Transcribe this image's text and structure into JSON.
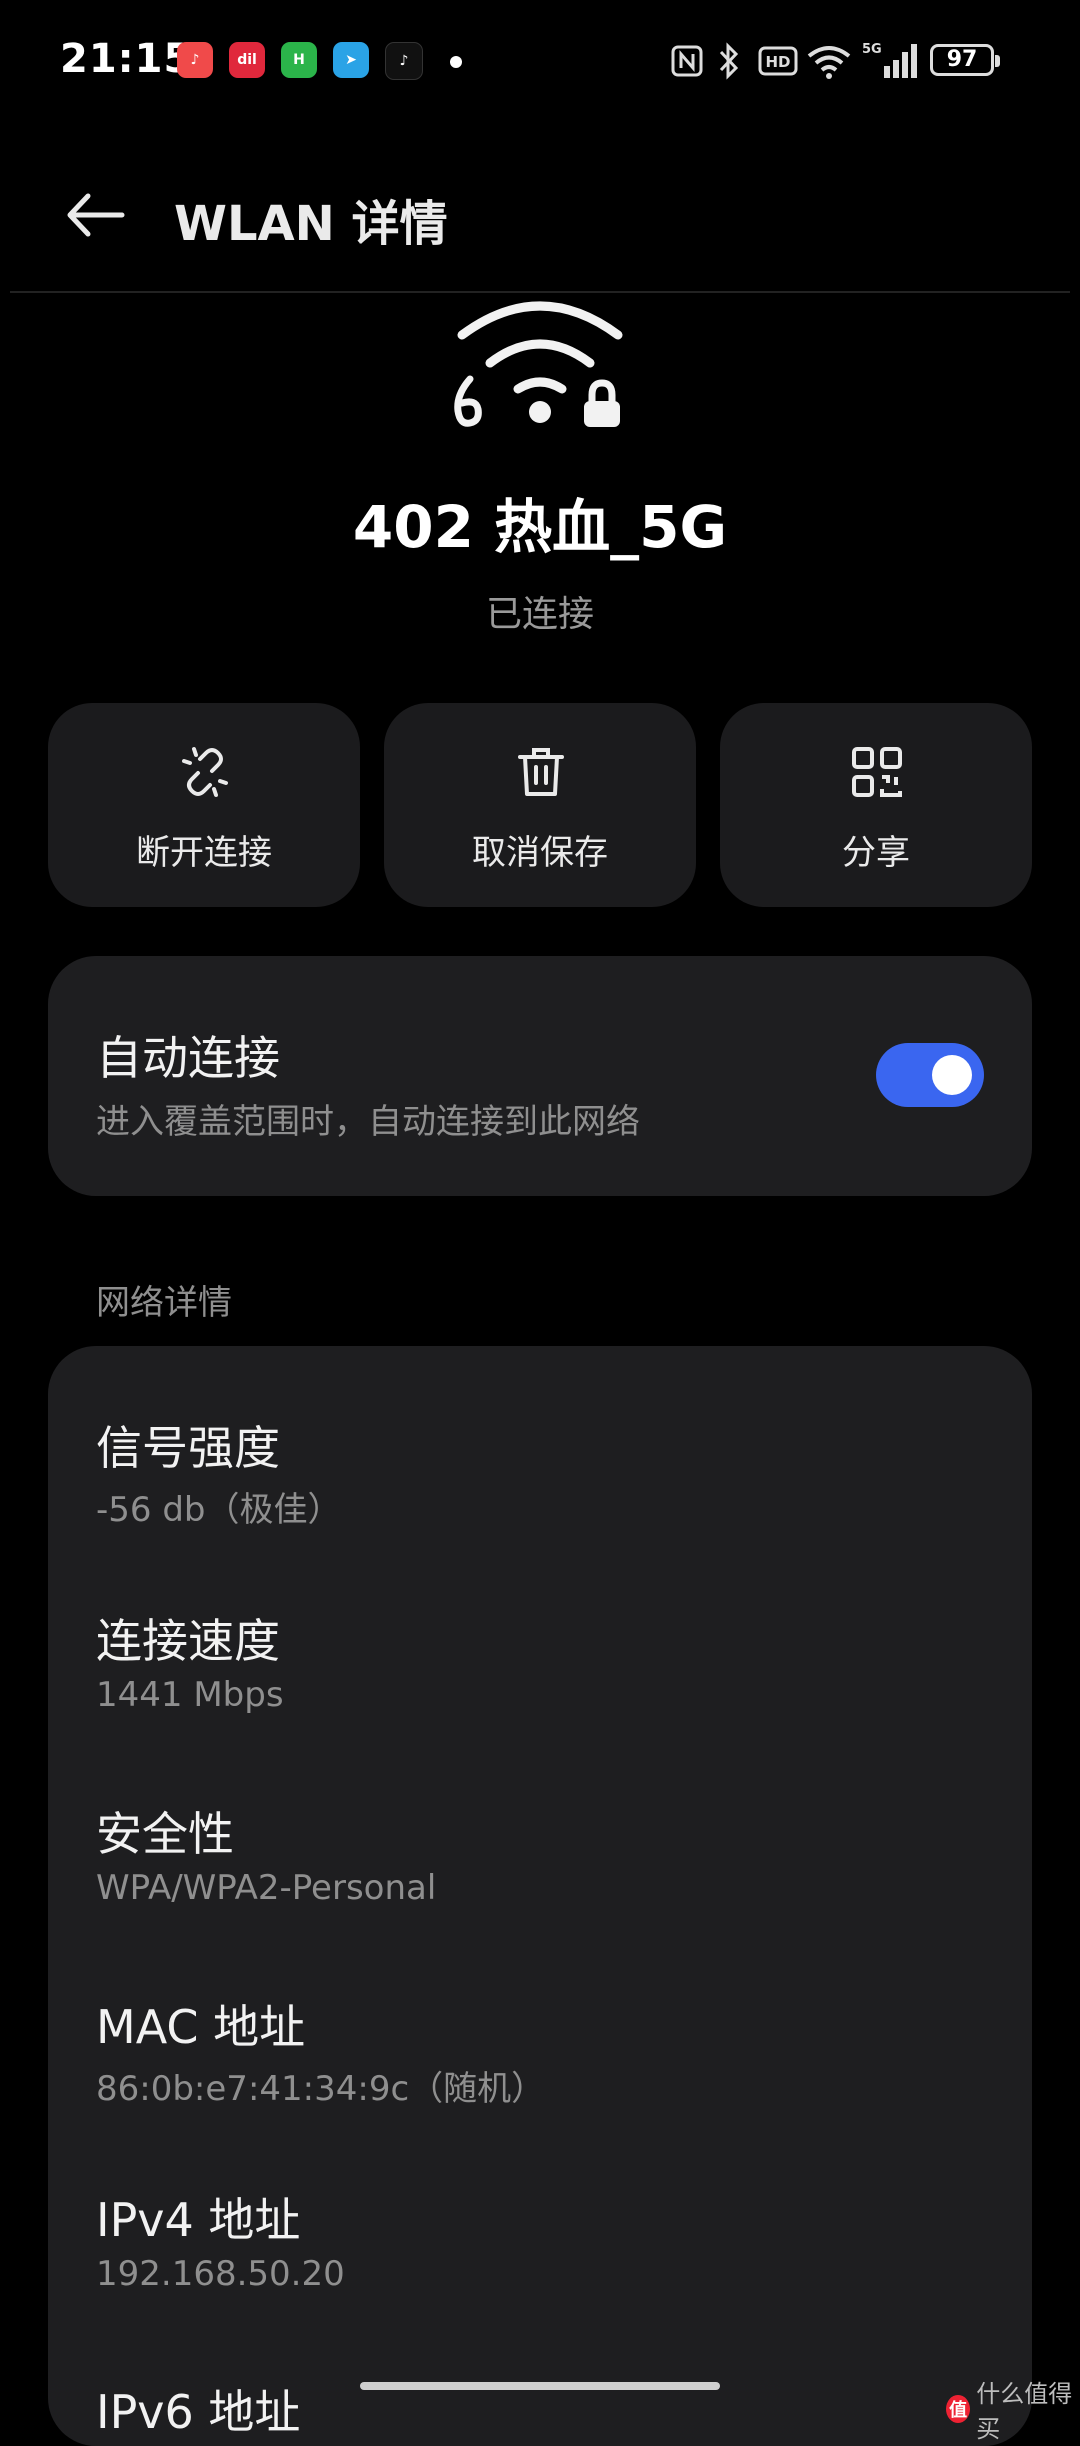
{
  "status_bar": {
    "time": "21:15",
    "apps": [
      {
        "icon": "music-app-icon",
        "color": "#f04a4a",
        "label": "♪"
      },
      {
        "icon": "app-icon",
        "color": "#e0283c",
        "label": "dil"
      },
      {
        "icon": "app-icon",
        "color": "#2bb44a",
        "label": "H"
      },
      {
        "icon": "telegram-icon",
        "color": "#2aa3e6",
        "label": "➤"
      },
      {
        "icon": "tiktok-icon",
        "color": "#111111",
        "label": "♪"
      }
    ],
    "battery": "97"
  },
  "header": {
    "title": "WLAN 详情"
  },
  "network": {
    "ssid": "402 热血_5G",
    "status": "已连接",
    "icon": "wifi-6-locked-icon"
  },
  "actions": [
    {
      "label": "断开连接",
      "icon": "disconnect-link-icon"
    },
    {
      "label": "取消保存",
      "icon": "trash-icon"
    },
    {
      "label": "分享",
      "icon": "qr-code-icon"
    }
  ],
  "auto_connect": {
    "title": "自动连接",
    "subtitle": "进入覆盖范围时，自动连接到此网络",
    "enabled": true,
    "accent": "#3a66f0"
  },
  "details": {
    "section_label": "网络详情",
    "items": [
      {
        "title": "信号强度",
        "value": "-56 db（极佳）"
      },
      {
        "title": "连接速度",
        "value": "1441 Mbps"
      },
      {
        "title": "安全性",
        "value": "WPA/WPA2-Personal"
      },
      {
        "title": "MAC 地址",
        "value": "86:0b:e7:41:34:9c（随机）"
      },
      {
        "title": "IPv4 地址",
        "value": "192.168.50.20"
      },
      {
        "title": "IPv6 地址",
        "value": ""
      }
    ]
  },
  "watermark": {
    "badge": "值",
    "text": "什么值得买"
  }
}
